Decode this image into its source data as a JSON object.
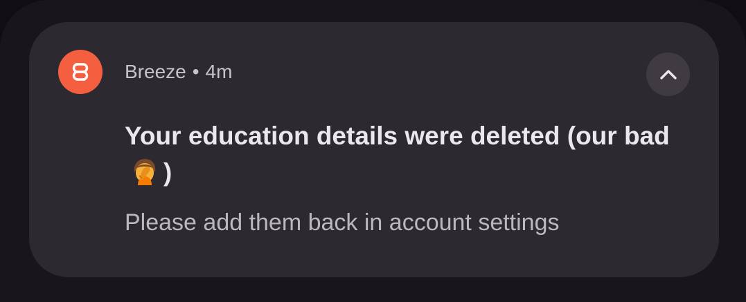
{
  "notification": {
    "app_icon": "breeze-logo-icon",
    "app_name": "Breeze",
    "separator": "•",
    "time": "4m",
    "title_before_emoji": "Your education details were deleted (our bad",
    "title_emoji": "face-palm-emoji",
    "title_after_emoji": ")",
    "body": "Please add them back in account settings",
    "collapse_icon": "chevron-up-icon"
  },
  "colors": {
    "app_accent": "#f4603f",
    "card_background": "#2d2930",
    "title_text": "#ece6ee",
    "secondary_text": "#bdb7c0"
  }
}
